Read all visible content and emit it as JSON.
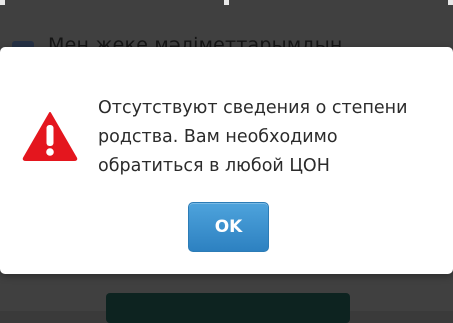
{
  "background": {
    "checkbox_label": "Мен жеке мәліметтарымдын"
  },
  "dialog": {
    "icon": "warning-icon",
    "message": "Отсутствуют сведения о степени родства. Вам необходимо обратиться в любой ЦОН",
    "ok_label": "OK"
  },
  "colors": {
    "warning": "#e4161e",
    "button": "#3a8fcf",
    "overlay": "#404040"
  }
}
